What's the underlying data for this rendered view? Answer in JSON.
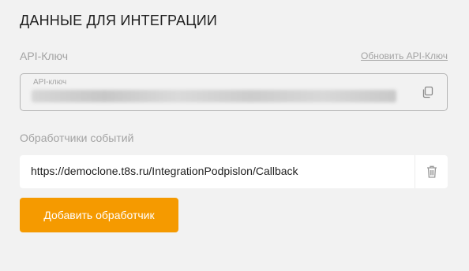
{
  "section": {
    "title": "ДАННЫЕ ДЛЯ ИНТЕГРАЦИИ"
  },
  "api_key": {
    "label": "API-Ключ",
    "renew_link": "Обновить API-Ключ",
    "field_caption": "API-ключ",
    "value": "",
    "copy_icon": "copy-icon"
  },
  "event_handlers": {
    "label": "Обработчики событий",
    "items": [
      {
        "url": "https://democlone.t8s.ru/IntegrationPodpislon/Callback",
        "delete_icon": "trash-icon"
      }
    ],
    "add_button": "Добавить обработчик"
  },
  "colors": {
    "accent": "#f59a00",
    "background": "#f2f2f2",
    "muted_text": "#a3a3a3",
    "text": "#1f1f1f"
  }
}
